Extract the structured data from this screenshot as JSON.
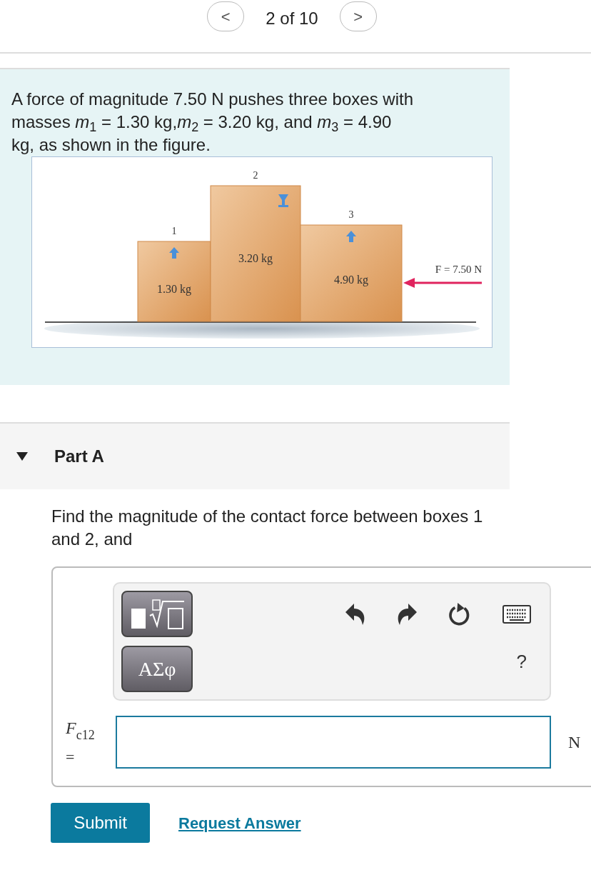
{
  "pager": {
    "prev": "<",
    "position": "2 of 10",
    "next": ">"
  },
  "problem": {
    "text": "A force of magnitude 7.50 N pushes three boxes with masses *m*$_{1}$ = 1.30 kg,*m*$_{2}$ = 3.20 kg, and *m*$_{3}$ = 4.90 kg, as shown in the figure.",
    "figure": {
      "boxes": [
        {
          "number": "1",
          "mass": "1.30 kg",
          "kind": "up-arrow"
        },
        {
          "number": "2",
          "mass": "3.20 kg",
          "kind": "glass"
        },
        {
          "number": "3",
          "mass": "4.90 kg",
          "kind": "up-arrow"
        }
      ],
      "force_label": "F = 7.50 N"
    }
  },
  "part": {
    "title": "Part A",
    "expanded": true,
    "question": "Find the magnitude of the contact force between boxes 1 and 2, and",
    "toolbar": {
      "greek_button": "ΑΣφ",
      "help": "?"
    },
    "answer": {
      "label": "F",
      "label_subscript": "c12",
      "equals": "=",
      "unit": "N"
    },
    "submit": "Submit",
    "request": "Request Answer"
  }
}
